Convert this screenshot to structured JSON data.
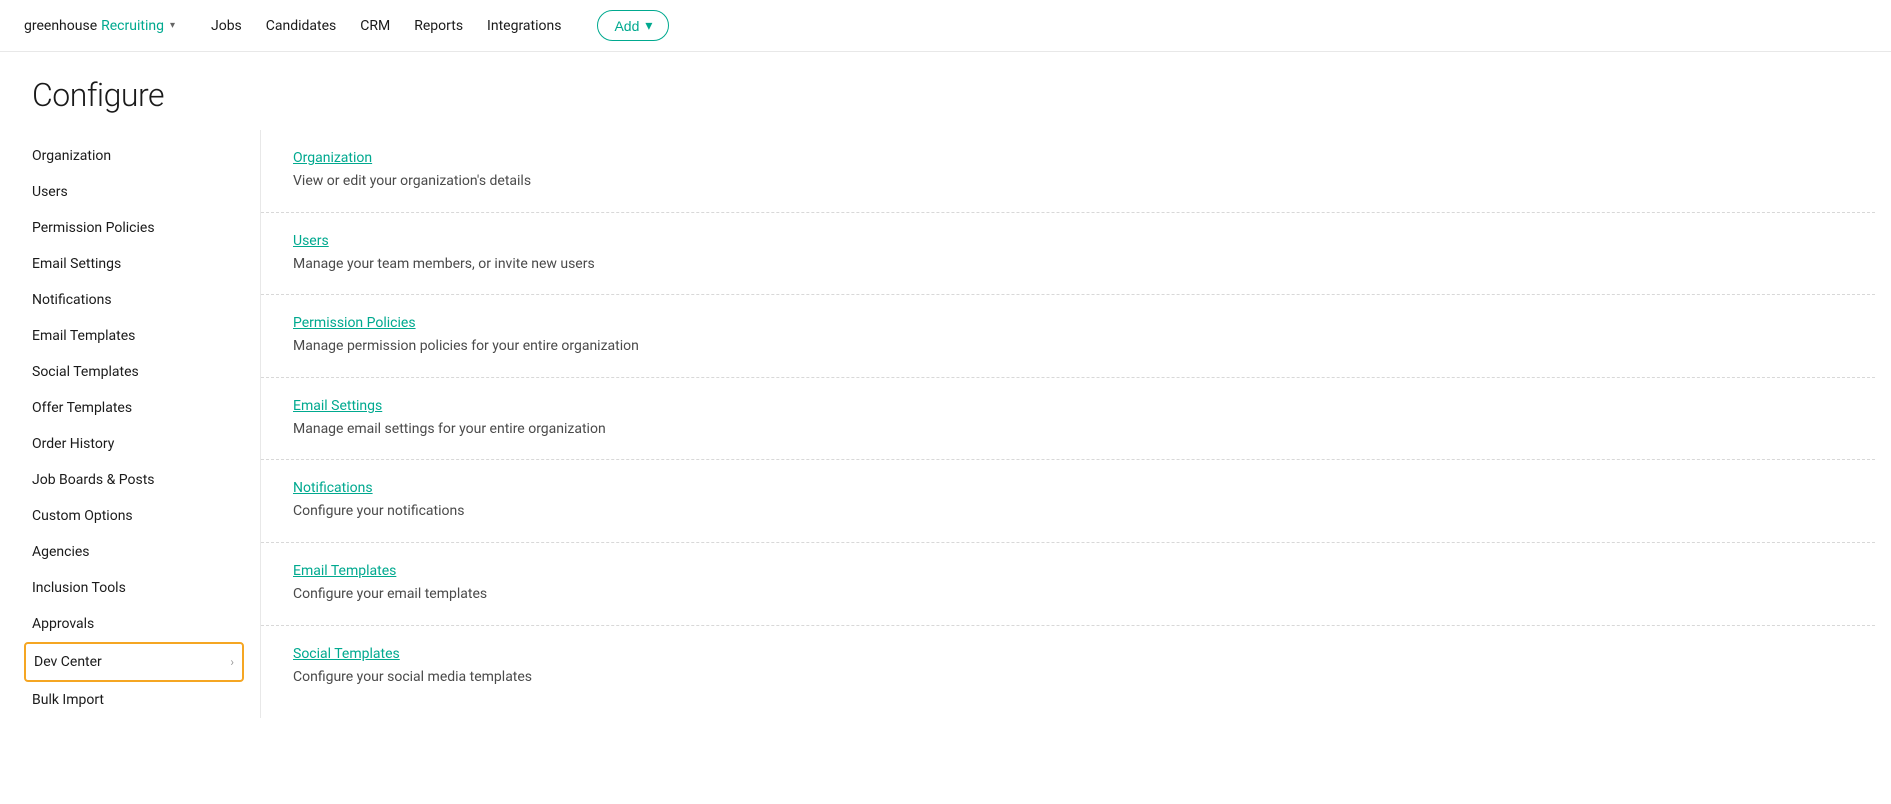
{
  "nav": {
    "logo_greenhouse": "greenhouse",
    "logo_recruiting": "Recruiting",
    "chevron": "▾",
    "links": [
      "Jobs",
      "Candidates",
      "CRM",
      "Reports",
      "Integrations"
    ],
    "add_button": "Add",
    "add_chevron": "▾"
  },
  "page": {
    "title": "Configure"
  },
  "sidebar": {
    "items": [
      {
        "label": "Organization",
        "active": false,
        "hasChevron": false
      },
      {
        "label": "Users",
        "active": false,
        "hasChevron": false
      },
      {
        "label": "Permission Policies",
        "active": false,
        "hasChevron": false
      },
      {
        "label": "Email Settings",
        "active": false,
        "hasChevron": false
      },
      {
        "label": "Notifications",
        "active": false,
        "hasChevron": false
      },
      {
        "label": "Email Templates",
        "active": false,
        "hasChevron": false
      },
      {
        "label": "Social Templates",
        "active": false,
        "hasChevron": false
      },
      {
        "label": "Offer Templates",
        "active": false,
        "hasChevron": false
      },
      {
        "label": "Order History",
        "active": false,
        "hasChevron": false
      },
      {
        "label": "Job Boards & Posts",
        "active": false,
        "hasChevron": false
      },
      {
        "label": "Custom Options",
        "active": false,
        "hasChevron": false
      },
      {
        "label": "Agencies",
        "active": false,
        "hasChevron": false
      },
      {
        "label": "Inclusion Tools",
        "active": false,
        "hasChevron": false
      },
      {
        "label": "Approvals",
        "active": false,
        "hasChevron": false
      },
      {
        "label": "Dev Center",
        "active": true,
        "hasChevron": true
      },
      {
        "label": "Bulk Import",
        "active": false,
        "hasChevron": false
      }
    ]
  },
  "main": {
    "items": [
      {
        "link": "Organization",
        "description": "View or edit your organization's details"
      },
      {
        "link": "Users",
        "description": "Manage your team members, or invite new users"
      },
      {
        "link": "Permission Policies",
        "description": "Manage permission policies for your entire organization"
      },
      {
        "link": "Email Settings",
        "description": "Manage email settings for your entire organization"
      },
      {
        "link": "Notifications",
        "description": "Configure your notifications"
      },
      {
        "link": "Email Templates",
        "description": "Configure your email templates"
      },
      {
        "link": "Social Templates",
        "description": "Configure your social media templates"
      }
    ]
  }
}
